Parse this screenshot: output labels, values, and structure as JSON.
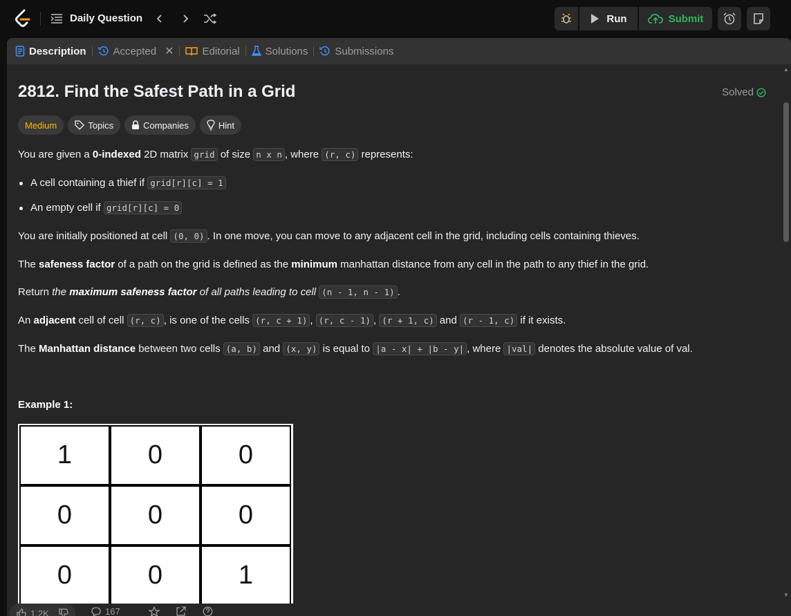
{
  "header": {
    "daily_label": "Daily Question",
    "run_label": "Run",
    "submit_label": "Submit",
    "icons": [
      "leetcode-logo-icon",
      "problem-list-icon",
      "chevron-left-icon",
      "chevron-right-icon",
      "shuffle-icon",
      "debug-icon",
      "play-icon",
      "cloud-upload-icon",
      "alarm-icon",
      "note-icon"
    ]
  },
  "tabs": [
    {
      "label": "Description",
      "icon": "description-icon",
      "active": true
    },
    {
      "label": "Accepted",
      "icon": "history-icon",
      "active": false
    },
    {
      "label": "Editorial",
      "icon": "book-icon",
      "active": false
    },
    {
      "label": "Solutions",
      "icon": "flask-icon",
      "active": false
    },
    {
      "label": "Submissions",
      "icon": "history-icon",
      "active": false
    }
  ],
  "problem": {
    "title": "2812. Find the Safest Path in a Grid",
    "status": "Solved",
    "difficulty": "Medium",
    "chips": [
      "Topics",
      "Companies",
      "Hint"
    ],
    "p1": {
      "a": "You are given a ",
      "b": "0-indexed",
      "c": " 2D matrix ",
      "code1": "grid",
      "d": " of size ",
      "code2": "n x n",
      "e": ", where ",
      "code3": "(r, c)",
      "f": " represents:"
    },
    "bullet1": {
      "text": "A cell containing a thief if ",
      "code": "grid[r][c] = 1"
    },
    "bullet2": {
      "text": "An empty cell if ",
      "code": "grid[r][c] = 0"
    },
    "p2": {
      "a": "You are initially positioned at cell ",
      "code": "(0, 0)",
      "b": ". In one move, you can move to any adjacent cell in the grid, including cells containing thieves."
    },
    "p3": {
      "a": "The ",
      "b": "safeness factor",
      "c": " of a path on the grid is defined as the ",
      "d": "minimum",
      "e": " manhattan distance from any cell in the path to any thief in the grid."
    },
    "p4": {
      "a": "Return ",
      "b": "the ",
      "c": "maximum safeness factor",
      "d": " of all paths leading to cell ",
      "code": "(n - 1, n - 1)",
      "e": "."
    },
    "p5": {
      "a": "An ",
      "b": "adjacent",
      "c": " cell of cell ",
      "code1": "(r, c)",
      "d": ", is one of the cells ",
      "code2": "(r, c + 1)",
      "e": ", ",
      "code3": "(r, c - 1)",
      "f": ", ",
      "code4": "(r + 1, c)",
      "g": " and ",
      "code5": "(r - 1, c)",
      "h": " if it exists."
    },
    "p6": {
      "a": "The ",
      "b": "Manhattan distance",
      "c": " between two cells ",
      "code1": "(a, b)",
      "d": " and ",
      "code2": "(x, y)",
      "e": " is equal to ",
      "code3": "|a - x| + |b - y|",
      "f": ", where ",
      "code4": "|val|",
      "g": " denotes the absolute value of val."
    },
    "example_title": "Example 1:",
    "example_grid": [
      [
        "1",
        "0",
        "0"
      ],
      [
        "0",
        "0",
        "0"
      ],
      [
        "0",
        "0",
        "1"
      ]
    ]
  },
  "footer": {
    "likes": "1.2K",
    "comments": "167"
  },
  "colors": {
    "accent_green": "#2db55d",
    "medium": "#ffb800",
    "bg": "#262626"
  }
}
